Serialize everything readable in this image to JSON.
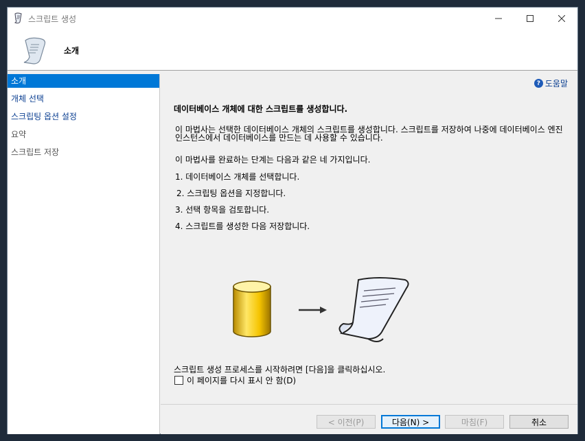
{
  "window": {
    "title": "스크립트 생성"
  },
  "header": {
    "title": "소개"
  },
  "sidebar": {
    "items": [
      {
        "label": "소개",
        "state": "selected"
      },
      {
        "label": "개체 선택",
        "state": "link"
      },
      {
        "label": "스크립팅 옵션 설정",
        "state": "link"
      },
      {
        "label": "요약",
        "state": "disabled"
      },
      {
        "label": "스크립트 저장",
        "state": "disabled"
      }
    ]
  },
  "content": {
    "help_label": "도움말",
    "heading": "데이터베이스 개체에 대한 스크립트를 생성합니다.",
    "paragraph": "이 마법사는 선택한 데이터베이스 개체의 스크립트를 생성합니다. 스크립트를 저장하여 나중에 데이터베이스 엔진 인스턴스에서 데이터베이스를 만드는 데 사용할 수 있습니다.",
    "steps_intro": "이 마법사를 완료하는 단계는 다음과 같은 네 가지입니다.",
    "steps": [
      "1. 데이터베이스 개체를 선택합니다.",
      "2. 스크립팅 옵션을 지정합니다.",
      "3. 선택 항목을 검토합니다.",
      "4. 스크립트를 생성한 다음 저장합니다."
    ],
    "start_text": "스크립트 생성 프로세스를 시작하려면 [다음]을 클릭하십시오.",
    "checkbox_label": "이 페이지를 다시 표시 안 함(D)",
    "checkbox_checked": false
  },
  "footer": {
    "prev_label": "< 이전(P)",
    "next_label": "다음(N) >",
    "finish_label": "마침(F)",
    "cancel_label": "취소"
  },
  "colors": {
    "selection": "#0078d7",
    "link": "#0b3f91"
  }
}
